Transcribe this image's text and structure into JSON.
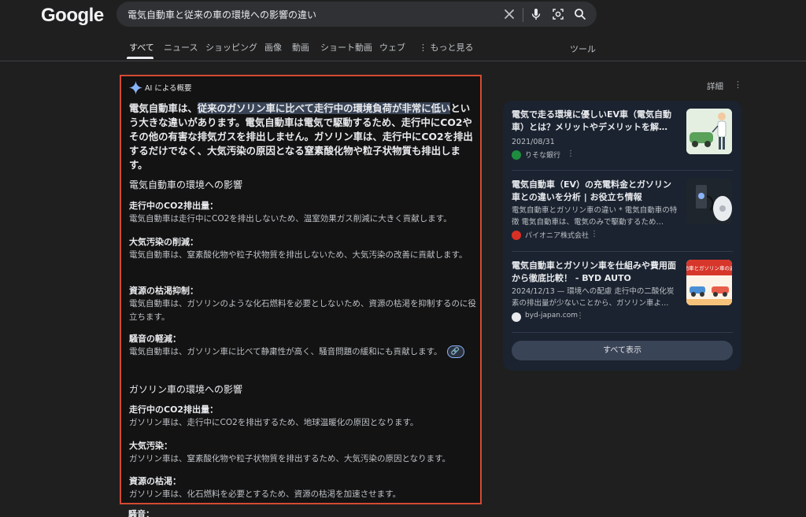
{
  "logo": "Google",
  "search": {
    "query": "電気自動車と従来の車の環境への影響の違い"
  },
  "tabs": [
    {
      "label": "すべて"
    },
    {
      "label": "ニュース"
    },
    {
      "label": "ショッピング"
    },
    {
      "label": "画像"
    },
    {
      "label": "動画"
    },
    {
      "label": "ショート動画"
    },
    {
      "label": "ウェブ"
    },
    {
      "label": "もっと見る"
    }
  ],
  "tools_label": "ツール",
  "ai_overview": {
    "header": "AI による概要",
    "lead_pre": "電気自動車は、",
    "lead_highlight": "従来のガソリン車に比べて走行中の環境負荷が非常に低い",
    "lead_post": "という大きな違いがあります。電気自動車は電気で駆動するため、走行中にCO2やその他の有害な排気ガスを排出しません。ガソリン車は、走行中にCO2を排出するだけでなく、大気汚染の原因となる窒素酸化物や粒子状物質も排出します。",
    "ev_section": {
      "title": "電気自動車の環境への影響",
      "items": [
        {
          "title": "走行中のCO2排出量：",
          "body": "電気自動車は走行中にCO2を排出しないため、温室効果ガス削減に大きく貢献します。"
        },
        {
          "title": "大気汚染の削減：",
          "body": "電気自動車は、窒素酸化物や粒子状物質を排出しないため、大気汚染の改善に貢献します。"
        },
        {
          "title": "資源の枯渇抑制：",
          "body": "電気自動車は、ガソリンのような化石燃料を必要としないため、資源の枯渇を抑制するのに役立ちます。"
        },
        {
          "title": "騒音の軽減：",
          "body": "電気自動車は、ガソリン車に比べて静粛性が高く、騒音問題の緩和にも貢献します。"
        }
      ]
    },
    "gas_section": {
      "title": "ガソリン車の環境への影響",
      "items": [
        {
          "title": "走行中のCO2排出量：",
          "body": "ガソリン車は、走行中にCO2を排出するため、地球温暖化の原因となります。"
        },
        {
          "title": "大気汚染：",
          "body": "ガソリン車は、窒素酸化物や粒子状物質を排出するため、大気汚染の原因となります。"
        },
        {
          "title": "資源の枯渇：",
          "body": "ガソリン車は、化石燃料を必要とするため、資源の枯渇を加速させます。"
        }
      ]
    },
    "next_item_title": "騒音："
  },
  "details_label": "詳細",
  "sources": [
    {
      "title": "電気で走る環境に優しいEV車（電気自動車）とは？メリットやデメリットを解…",
      "snippet": "2021/08/31",
      "source": "りそな銀行",
      "favicon_color": "#1e8e3e"
    },
    {
      "title": "電気自動車（EV）の充電料金とガソリン車との違いを分析 | お役立ち情報",
      "snippet": "電気自動車とガソリン車の違い * 電気自動車の特徴 電気自動車は、電気のみで駆動するため…",
      "source": "パイオニア株式会社",
      "favicon_color": "#d93025"
    },
    {
      "title": "電気自動車とガソリン車を仕組みや費用面から徹底比較！ - BYD AUTO",
      "snippet": "2024/12/13 — 環境への配慮 走行中の二酸化炭素の排出量が少ないことから、ガソリン車よ…",
      "source": "byd-japan.com",
      "favicon_color": "#e8eaed"
    }
  ],
  "show_all_label": "すべて表示",
  "thumb3_caption": "電気自動車とガソリン車の違いは？"
}
